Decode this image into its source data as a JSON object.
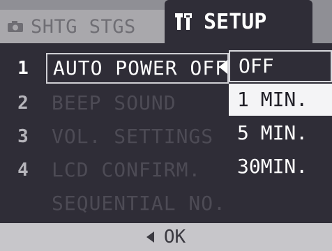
{
  "tabs": {
    "shooting_label": "SHTG STGS",
    "setup_label": "SETUP",
    "shooting_icon": "camera-icon",
    "setup_icon": "tools-icon"
  },
  "menu": {
    "rows": [
      {
        "number": "1",
        "label": "AUTO POWER OFF"
      },
      {
        "number": "2",
        "label": "BEEP SOUND"
      },
      {
        "number": "3",
        "label": "VOL. SETTINGS"
      },
      {
        "number": "4",
        "label": "LCD CONFIRM."
      },
      {
        "number": "",
        "label": "SEQUENTIAL NO."
      }
    ]
  },
  "dropdown": {
    "options": [
      "OFF",
      "1 MIN.",
      "5 MIN.",
      "30MIN."
    ],
    "current": "OFF",
    "highlighted": "1 MIN."
  },
  "footer": {
    "back_icon": "left-triangle-icon",
    "ok_label": "OK"
  },
  "colors": {
    "panel": "#2f2d37",
    "highlight": "#f4f4f6",
    "tab_bar": "#8f8f95",
    "footer": "#c7c6ca"
  }
}
